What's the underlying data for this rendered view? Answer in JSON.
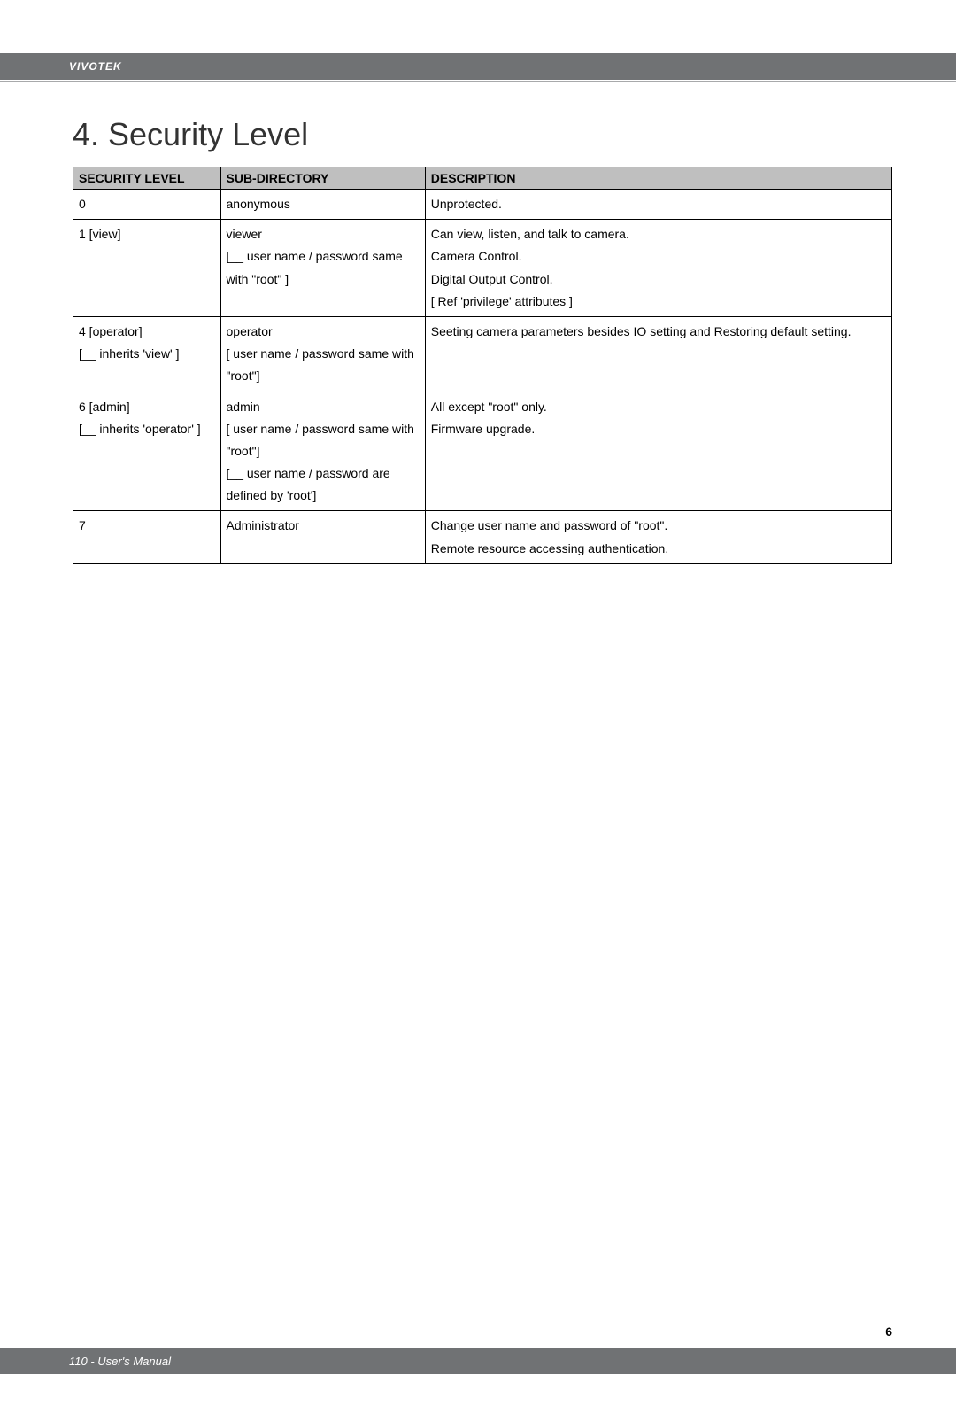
{
  "header": {
    "brand": "VIVOTEK"
  },
  "section": {
    "title": "4. Security Level"
  },
  "table": {
    "headers": {
      "col1": "SECURITY LEVEL",
      "col2": "SUB-DIRECTORY",
      "col3": "DESCRIPTION"
    },
    "rows": [
      {
        "c1": "0",
        "c2": "anonymous",
        "c3": "Unprotected."
      },
      {
        "c1": "1 [view]",
        "c2": "viewer\n[__ user name / password same with \"root\" ]",
        "c3": "Can view, listen, and talk to camera.\nCamera Control.\nDigital Output Control.\n[ Ref 'privilege' attributes ]"
      },
      {
        "c1": "4 [operator]\n[__ inherits 'view' ]",
        "c2": "operator\n[ user name / password same with \"root\"]",
        "c3": "Seeting camera parameters besides IO setting and Restoring default setting."
      },
      {
        "c1": "6 [admin]\n[__ inherits 'operator' ]",
        "c2": "admin\n[ user name / password same with \"root\"]\n[__ user name / password are defined by 'root']",
        "c3": "All except \"root\" only.\nFirmware upgrade."
      },
      {
        "c1": "7",
        "c2": "Administrator",
        "c3": "Change user name and password of \"root\".\nRemote resource accessing authentication."
      }
    ]
  },
  "footer": {
    "page_number": "6",
    "manual_text": "110 - User's Manual"
  }
}
